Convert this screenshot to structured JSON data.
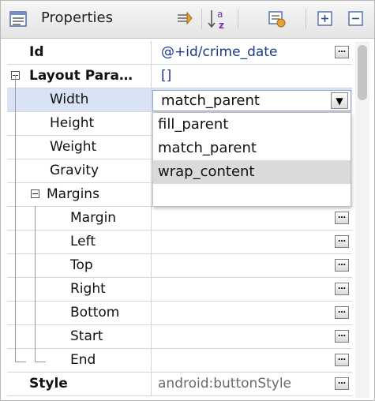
{
  "header": {
    "title": "Properties",
    "toolbar": [
      "show-advanced-icon",
      "sort-alphabetical-icon",
      "restore-defaults-icon",
      "expand-all-icon",
      "collapse-all-icon"
    ],
    "sort_glyph_top": "a",
    "sort_glyph_bottom": "z"
  },
  "rows": {
    "id": {
      "name": "Id",
      "value": "@+id/crime_date",
      "button": "…"
    },
    "layout_params": {
      "name": "Layout Para…",
      "value": "[]"
    },
    "width": {
      "name": "Width"
    },
    "height": {
      "name": "Height"
    },
    "weight": {
      "name": "Weight"
    },
    "gravity": {
      "name": "Gravity"
    },
    "margins": {
      "name": "Margins"
    },
    "margin": {
      "name": "Margin",
      "button": "…"
    },
    "left": {
      "name": "Left",
      "button": "…"
    },
    "top": {
      "name": "Top",
      "button": "…"
    },
    "right": {
      "name": "Right",
      "button": "…"
    },
    "bottom": {
      "name": "Bottom",
      "button": "…"
    },
    "start": {
      "name": "Start",
      "button": "…"
    },
    "end": {
      "name": "End",
      "button": "…"
    },
    "style": {
      "name": "Style",
      "value": "android:buttonStyle",
      "button": "…"
    }
  },
  "width_combo": {
    "value": "match_parent",
    "arrow": "▼",
    "options": [
      "fill_parent",
      "match_parent",
      "wrap_content"
    ],
    "highlighted": "wrap_content"
  },
  "colors": {
    "selection": "#d8e4f5",
    "value_text": "#1b3a8c",
    "sort_icon_accent": "#7b2fb5"
  }
}
